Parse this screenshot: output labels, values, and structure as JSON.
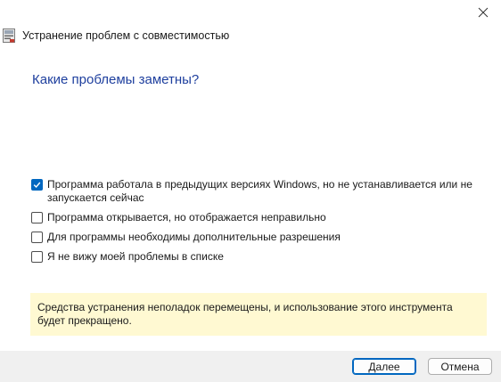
{
  "window": {
    "title": "Устранение проблем с совместимостью"
  },
  "page": {
    "heading": "Какие проблемы заметны?"
  },
  "options": [
    {
      "label": "Программа работала в предыдущих версиях Windows, но не устанавливается или не запускается сейчас",
      "checked": true
    },
    {
      "label": "Программа открывается, но отображается неправильно",
      "checked": false
    },
    {
      "label": "Для программы необходимы дополнительные разрешения",
      "checked": false
    },
    {
      "label": "Я не вижу моей проблемы в списке",
      "checked": false
    }
  ],
  "notice": {
    "text": "Средства устранения неполадок перемещены, и использование этого инструмента будет прекращено."
  },
  "buttons": {
    "next_label": "Далее",
    "cancel_label": "Отмена"
  },
  "colors": {
    "accent": "#0067c0",
    "heading": "#1e3f9e",
    "notice_bg": "#fff9d2",
    "footer_bg": "#f0f0f0"
  },
  "icons": {
    "close": "close-icon",
    "app": "compatibility-troubleshooter-icon",
    "check": "checkmark-icon"
  }
}
